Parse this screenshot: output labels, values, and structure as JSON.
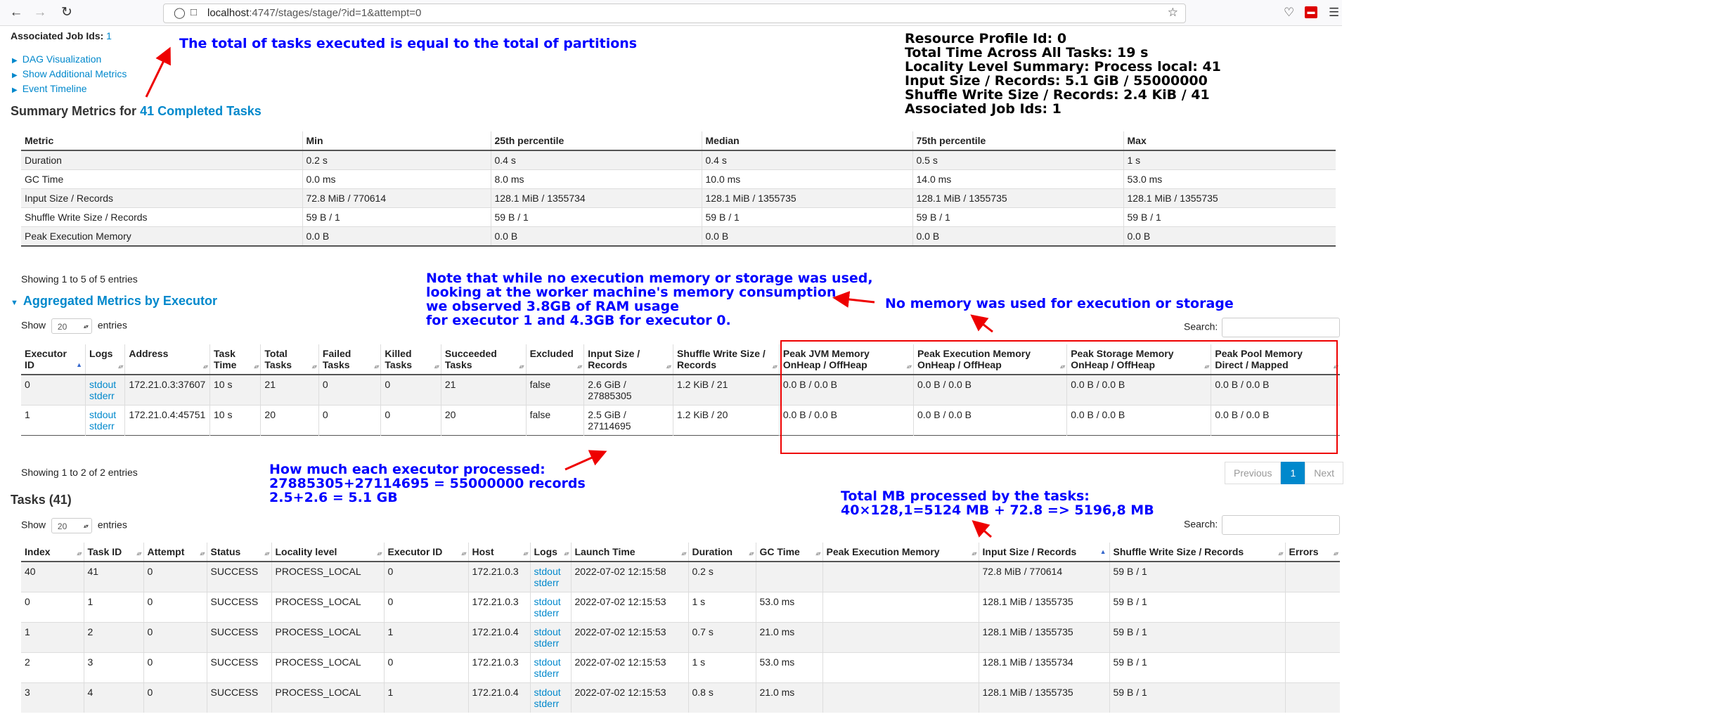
{
  "browser": {
    "url_host": "localhost",
    "url_rest": ":4747/stages/stage/?id=1&attempt=0"
  },
  "header": {
    "assoc_job_label": "Associated Job Ids:",
    "assoc_job_value": "1",
    "expanders": [
      "DAG Visualization",
      "Show Additional Metrics",
      "Event Timeline"
    ]
  },
  "resource_summary": {
    "lines": [
      "Resource Profile Id: 0",
      "Total Time Across All Tasks: 19 s",
      "Locality Level Summary: Process local: 41",
      "Input Size / Records: 5.1 GiB / 55000000",
      "Shuffle Write Size / Records: 2.4 KiB / 41",
      "Associated Job Ids: 1"
    ]
  },
  "annotations": {
    "partitions": "The total of tasks executed is equal to the total of partitions",
    "memory_note": [
      "Note that while no execution memory or storage was used,",
      "looking at the worker machine's memory consumption",
      "we observed 3.8GB of RAM usage",
      "for executor 1 and 4.3GB for executor 0."
    ],
    "no_memory": "No memory was used for execution or storage",
    "executor_processed": [
      "How much each executor processed:",
      "27885305+27114695 = 55000000 records",
      "2.5+2.6 = 5.1 GB"
    ],
    "total_mb": [
      "Total MB processed by the tasks:",
      "40×128,1=5124 MB + 72.8 => 5196,8 MB"
    ]
  },
  "summary": {
    "title_prefix": "Summary Metrics for",
    "title_link": "41 Completed Tasks",
    "headers": [
      "Metric",
      "Min",
      "25th percentile",
      "Median",
      "75th percentile",
      "Max"
    ],
    "rows": [
      [
        "Duration",
        "0.2 s",
        "0.4 s",
        "0.4 s",
        "0.5 s",
        "1 s"
      ],
      [
        "GC Time",
        "0.0 ms",
        "8.0 ms",
        "10.0 ms",
        "14.0 ms",
        "53.0 ms"
      ],
      [
        "Input Size / Records",
        "72.8 MiB / 770614",
        "128.1 MiB / 1355734",
        "128.1 MiB / 1355735",
        "128.1 MiB / 1355735",
        "128.1 MiB / 1355735"
      ],
      [
        "Shuffle Write Size / Records",
        "59 B / 1",
        "59 B / 1",
        "59 B / 1",
        "59 B / 1",
        "59 B / 1"
      ],
      [
        "Peak Execution Memory",
        "0.0 B",
        "0.0 B",
        "0.0 B",
        "0.0 B",
        "0.0 B"
      ]
    ],
    "showing": "Showing 1 to 5 of 5 entries"
  },
  "executors": {
    "title": "Aggregated Metrics by Executor",
    "show_label": "Show",
    "show_value": "20",
    "entries_label": "entries",
    "search_label": "Search:",
    "headers": [
      [
        "Executor",
        "ID"
      ],
      [
        "Logs",
        ""
      ],
      [
        "Address",
        ""
      ],
      [
        "Task",
        "Time"
      ],
      [
        "Total",
        "Tasks"
      ],
      [
        "Failed",
        "Tasks"
      ],
      [
        "Killed",
        "Tasks"
      ],
      [
        "Succeeded",
        "Tasks"
      ],
      [
        "Excluded",
        ""
      ],
      [
        "Input Size /",
        "Records"
      ],
      [
        "Shuffle Write Size /",
        "Records"
      ],
      [
        "Peak JVM Memory",
        "OnHeap / OffHeap"
      ],
      [
        "Peak Execution Memory",
        "OnHeap / OffHeap"
      ],
      [
        "Peak Storage Memory",
        "OnHeap / OffHeap"
      ],
      [
        "Peak Pool Memory",
        "Direct / Mapped"
      ]
    ],
    "rows": [
      {
        "id": "0",
        "stdout": "stdout",
        "stderr": "stderr",
        "address": "172.21.0.3:37607",
        "time": "10 s",
        "total": "21",
        "failed": "0",
        "killed": "0",
        "succeeded": "21",
        "excluded": "false",
        "input1": "2.6 GiB /",
        "input2": "27885305",
        "shuffle": "1.2 KiB / 21",
        "jvm": "0.0 B / 0.0 B",
        "exec": "0.0 B / 0.0 B",
        "storage": "0.0 B / 0.0 B",
        "pool": "0.0 B / 0.0 B"
      },
      {
        "id": "1",
        "stdout": "stdout",
        "stderr": "stderr",
        "address": "172.21.0.4:45751",
        "time": "10 s",
        "total": "20",
        "failed": "0",
        "killed": "0",
        "succeeded": "20",
        "excluded": "false",
        "input1": "2.5 GiB /",
        "input2": "27114695",
        "shuffle": "1.2 KiB / 20",
        "jvm": "0.0 B / 0.0 B",
        "exec": "0.0 B / 0.0 B",
        "storage": "0.0 B / 0.0 B",
        "pool": "0.0 B / 0.0 B"
      }
    ],
    "showing": "Showing 1 to 2 of 2 entries",
    "pager": {
      "previous": "Previous",
      "page": "1",
      "next": "Next"
    }
  },
  "tasks": {
    "title": "Tasks (41)",
    "show_label": "Show",
    "show_value": "20",
    "entries_label": "entries",
    "search_label": "Search:",
    "headers": [
      "Index",
      "Task ID",
      "Attempt",
      "Status",
      "Locality level",
      "Executor ID",
      "Host",
      "Logs",
      "Launch Time",
      "Duration",
      "GC Time",
      "Peak Execution Memory",
      "Input Size / Records",
      "Shuffle Write Size / Records",
      "Errors"
    ],
    "rows": [
      {
        "index": "40",
        "task": "41",
        "attempt": "0",
        "status": "SUCCESS",
        "locality": "PROCESS_LOCAL",
        "exec": "0",
        "host": "172.21.0.3",
        "stdout": "stdout",
        "stderr": "stderr",
        "launch": "2022-07-02 12:15:58",
        "duration": "0.2 s",
        "gc": "",
        "peak": "",
        "input": "72.8 MiB / 770614",
        "shuffle": "59 B / 1",
        "errors": ""
      },
      {
        "index": "0",
        "task": "1",
        "attempt": "0",
        "status": "SUCCESS",
        "locality": "PROCESS_LOCAL",
        "exec": "0",
        "host": "172.21.0.3",
        "stdout": "stdout",
        "stderr": "stderr",
        "launch": "2022-07-02 12:15:53",
        "duration": "1 s",
        "gc": "53.0 ms",
        "peak": "",
        "input": "128.1 MiB / 1355735",
        "shuffle": "59 B / 1",
        "errors": ""
      },
      {
        "index": "1",
        "task": "2",
        "attempt": "0",
        "status": "SUCCESS",
        "locality": "PROCESS_LOCAL",
        "exec": "1",
        "host": "172.21.0.4",
        "stdout": "stdout",
        "stderr": "stderr",
        "launch": "2022-07-02 12:15:53",
        "duration": "0.7 s",
        "gc": "21.0 ms",
        "peak": "",
        "input": "128.1 MiB / 1355735",
        "shuffle": "59 B / 1",
        "errors": ""
      },
      {
        "index": "2",
        "task": "3",
        "attempt": "0",
        "status": "SUCCESS",
        "locality": "PROCESS_LOCAL",
        "exec": "0",
        "host": "172.21.0.3",
        "stdout": "stdout",
        "stderr": "stderr",
        "launch": "2022-07-02 12:15:53",
        "duration": "1 s",
        "gc": "53.0 ms",
        "peak": "",
        "input": "128.1 MiB / 1355734",
        "shuffle": "59 B / 1",
        "errors": ""
      },
      {
        "index": "3",
        "task": "4",
        "attempt": "0",
        "status": "SUCCESS",
        "locality": "PROCESS_LOCAL",
        "exec": "1",
        "host": "172.21.0.4",
        "stdout": "stdout",
        "stderr": "stderr",
        "launch": "2022-07-02 12:15:53",
        "duration": "0.8 s",
        "gc": "21.0 ms",
        "peak": "",
        "input": "128.1 MiB / 1355735",
        "shuffle": "59 B / 1",
        "errors": ""
      }
    ]
  }
}
